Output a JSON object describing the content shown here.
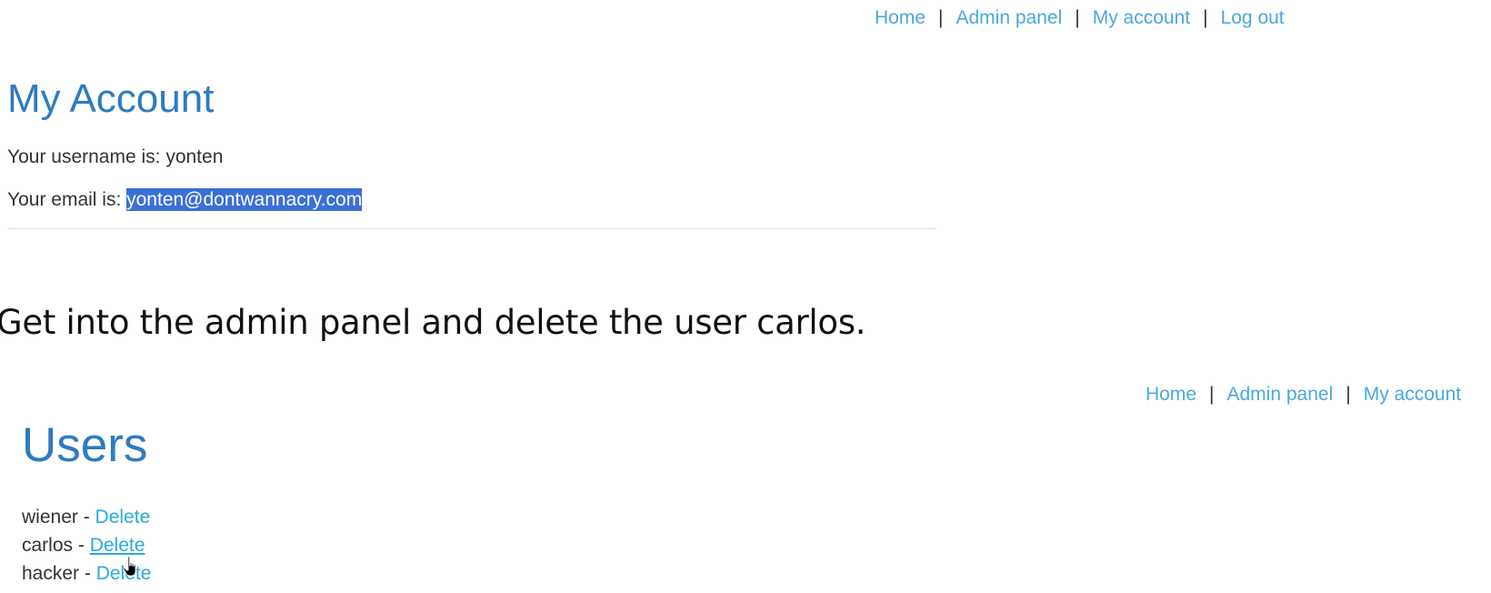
{
  "top_nav": {
    "home": "Home",
    "admin_panel": "Admin panel",
    "my_account": "My account",
    "log_out": "Log out",
    "separator": "|"
  },
  "account": {
    "title": "My Account",
    "username_label": "Your username is: ",
    "username": "yonten",
    "email_label": "Your email is: ",
    "email": "yonten@dontwannacry.com"
  },
  "task": {
    "text": "Get into the admin panel and delete the user carlos."
  },
  "bottom_nav": {
    "home": "Home",
    "admin_panel": "Admin panel",
    "my_account": "My account",
    "separator": "|"
  },
  "users": {
    "title": "Users",
    "dash": " - ",
    "delete_label": "Delete",
    "list": [
      {
        "name": "wiener"
      },
      {
        "name": "carlos"
      },
      {
        "name": "hacker"
      }
    ]
  },
  "colors": {
    "link": "#29a9df",
    "heading": "#2f7bbf",
    "selection": "#3b6fd8"
  }
}
